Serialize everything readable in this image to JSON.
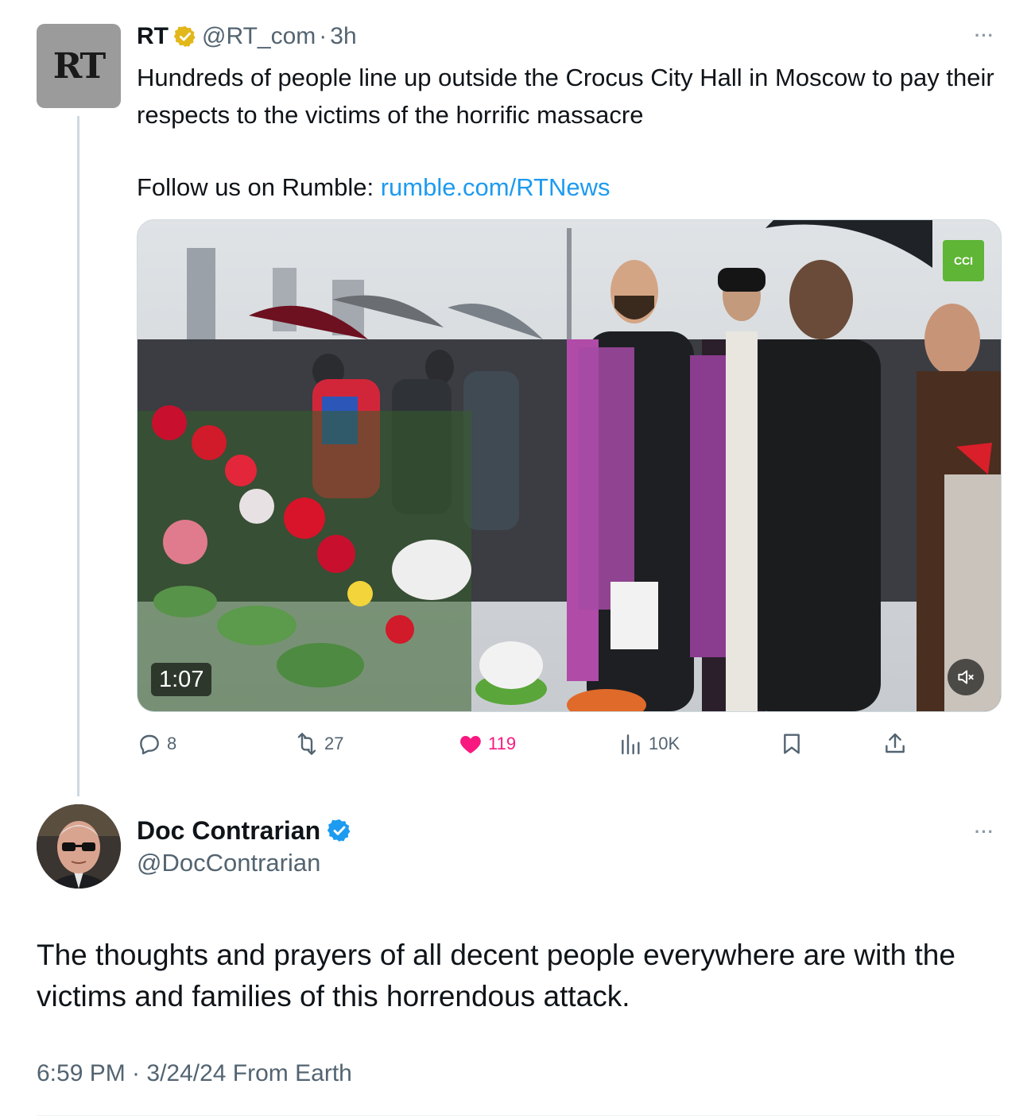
{
  "quoted_tweet": {
    "display_name": "RT",
    "handle": "@RT_com",
    "separator": "·",
    "time": "3h",
    "avatar_text": "RT",
    "text": "Hundreds of people line up outside the Crocus City Hall in Moscow to pay their respects to the victims of the horrific massacre",
    "follow_prefix": "Follow us on Rumble: ",
    "follow_link": "rumble.com/RTNews",
    "video": {
      "duration": "1:07",
      "watermark": "CCI"
    },
    "stats": {
      "replies": "8",
      "retweets": "27",
      "likes": "119",
      "views": "10K"
    },
    "more_menu": "···"
  },
  "main_tweet": {
    "display_name": "Doc Contrarian",
    "handle": "@DocContrarian",
    "text": "The thoughts and prayers of all decent people everywhere are with the victims and families of this horrendous attack.",
    "timestamp": "6:59 PM · 3/24/24 From Earth",
    "more_menu": "···"
  },
  "colors": {
    "link": "#1d9bf0",
    "like": "#f91880",
    "muted": "#536471",
    "verified_gold": "#e2b719",
    "verified_blue": "#1d9bf0"
  },
  "icons": [
    "verified-gold-badge-icon",
    "verified-blue-badge-icon",
    "reply-icon",
    "retweet-icon",
    "like-icon",
    "views-icon",
    "bookmark-icon",
    "share-icon",
    "mute-icon",
    "more-icon"
  ]
}
